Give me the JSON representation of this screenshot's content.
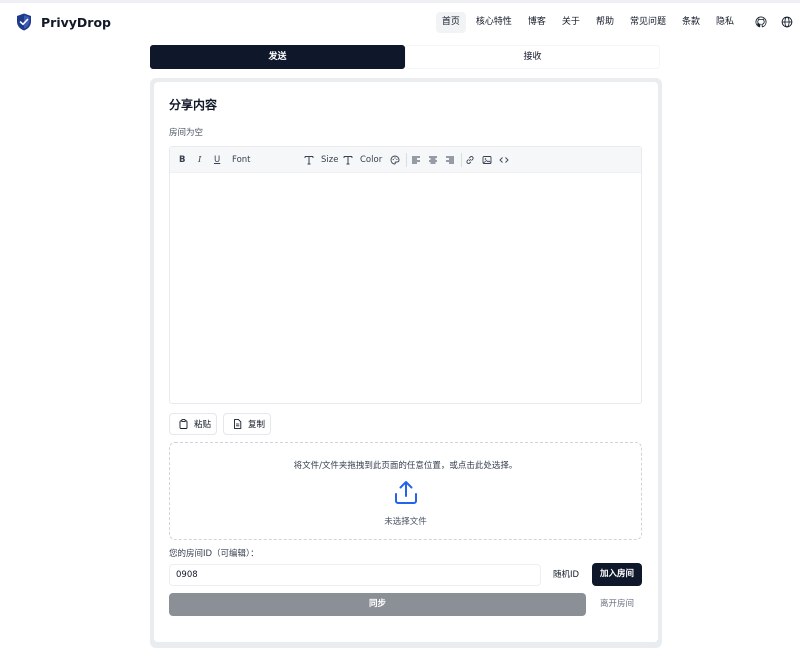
{
  "app": {
    "name": "PrivyDrop",
    "brand_color": "#1e3a8a"
  },
  "nav": {
    "items": [
      {
        "label": "首页",
        "active": true
      },
      {
        "label": "核心特性"
      },
      {
        "label": "博客"
      },
      {
        "label": "关于"
      },
      {
        "label": "帮助"
      },
      {
        "label": "常见问题"
      },
      {
        "label": "条款"
      },
      {
        "label": "隐私"
      }
    ],
    "icons": [
      "github-icon",
      "globe-icon"
    ]
  },
  "tabs": {
    "send": "发送",
    "receive": "接收",
    "active": "send"
  },
  "share": {
    "title": "分享内容",
    "room_status": "房间为空",
    "toolbar": {
      "bold": "B",
      "italic": "I",
      "underline": "U",
      "font": "Font",
      "size": "Size",
      "color": "Color"
    },
    "paste_label": "粘贴",
    "copy_label": "复制",
    "dropzone": {
      "hint": "将文件/文件夹拖拽到此页面的任意位置，或点击此处选择。",
      "no_file": "未选择文件",
      "icon": "upload-icon",
      "accent": "#2563eb"
    }
  },
  "room": {
    "label": "您的房间ID（可编辑）：",
    "value": "0908",
    "random_label": "随机ID",
    "join_label": "加入房间",
    "sync_label": "同步",
    "leave_label": "离开房间"
  }
}
